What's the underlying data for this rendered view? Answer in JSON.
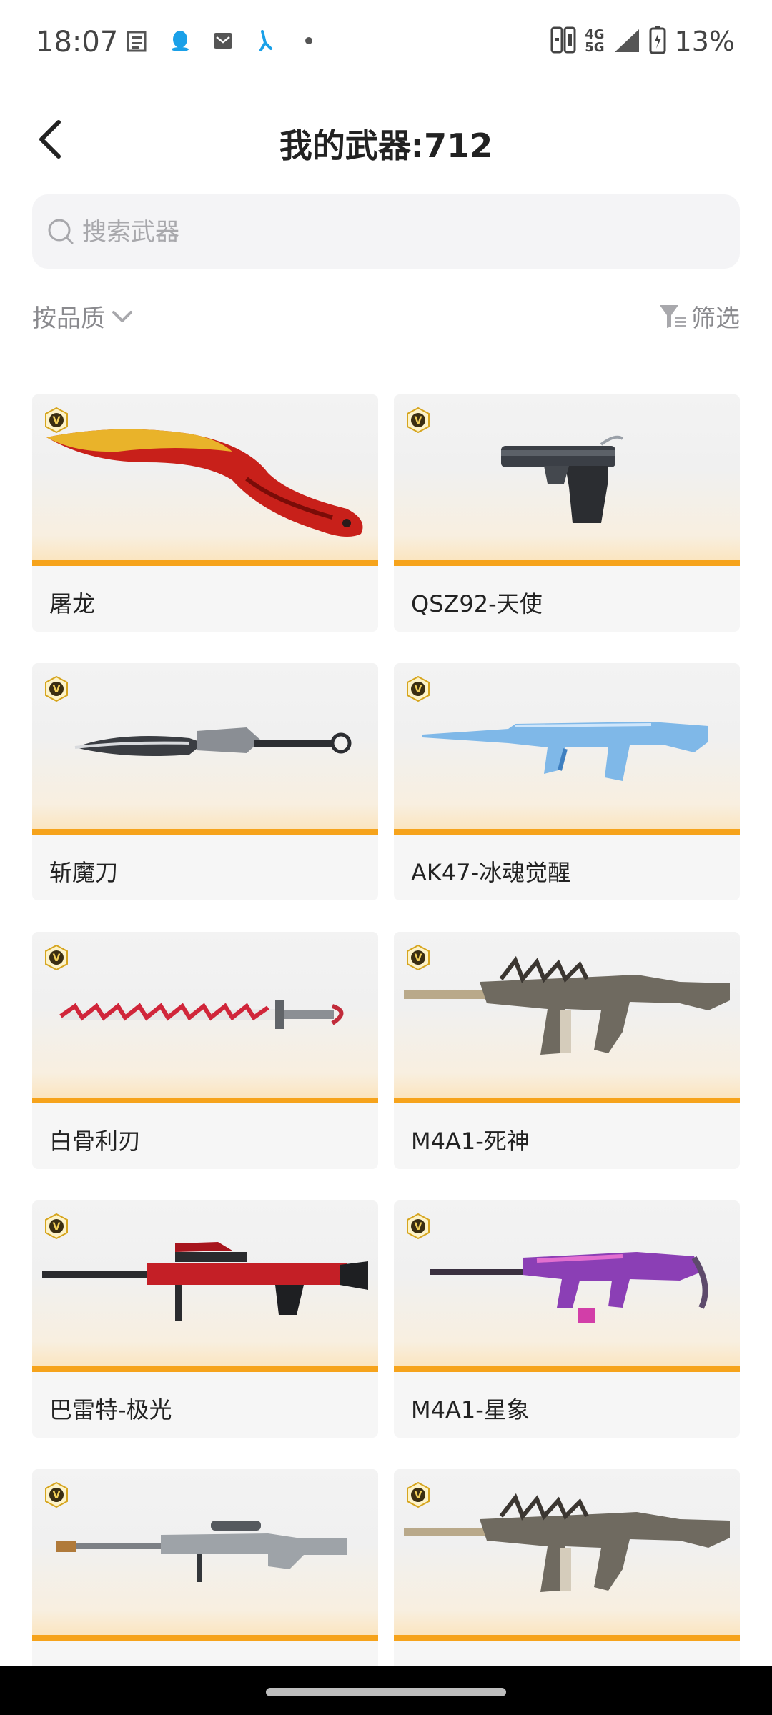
{
  "status_bar": {
    "time": "18:07",
    "network_top": "4G",
    "network_bottom": "5G",
    "battery": "13%"
  },
  "header": {
    "title": "我的武器:712"
  },
  "search": {
    "placeholder": "搜索武器",
    "value": ""
  },
  "toolbar": {
    "sort_label": "按品质",
    "filter_label": "筛选"
  },
  "weapons": [
    {
      "name": "屠龙"
    },
    {
      "name": "QSZ92-天使"
    },
    {
      "name": "斩魔刀"
    },
    {
      "name": "AK47-冰魂觉醒"
    },
    {
      "name": "白骨利刃"
    },
    {
      "name": "M4A1-死神"
    },
    {
      "name": "巴雷特-极光"
    },
    {
      "name": "M4A1-星象"
    },
    {
      "name": ""
    },
    {
      "name": ""
    }
  ],
  "colors": {
    "accent_orange": "#f6a31b",
    "badge_gold": "#d6a51e",
    "placeholder": "#a8a8ac"
  }
}
